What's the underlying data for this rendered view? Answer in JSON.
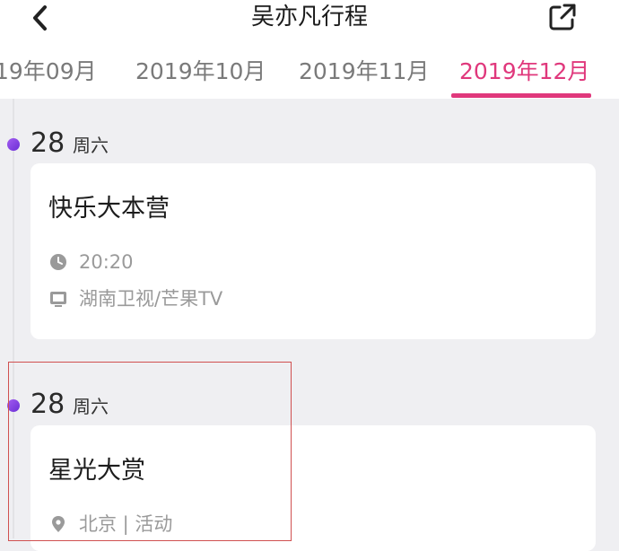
{
  "header": {
    "title": "吴亦凡行程",
    "back_icon": "chevron-left-icon",
    "share_icon": "external-link-icon"
  },
  "tabs": [
    {
      "label": "19年09月",
      "active": false
    },
    {
      "label": "2019年10月",
      "active": false
    },
    {
      "label": "2019年11月",
      "active": false
    },
    {
      "label": "2019年12月",
      "active": true
    }
  ],
  "colors": {
    "accent": "#e0387c",
    "dot": "#8a45e6",
    "background": "#efeff2",
    "muted_text": "#9a9a9a"
  },
  "events": [
    {
      "date": "28",
      "weekday": "周六",
      "title": "快乐大本营",
      "meta": [
        {
          "icon": "clock-icon",
          "text": "20:20"
        },
        {
          "icon": "tv-icon",
          "text": "湖南卫视/芒果TV"
        }
      ]
    },
    {
      "date": "28",
      "weekday": "周六",
      "title": "星光大赏",
      "meta": [
        {
          "icon": "location-pin-icon",
          "text": "北京 | 活动"
        }
      ]
    }
  ]
}
